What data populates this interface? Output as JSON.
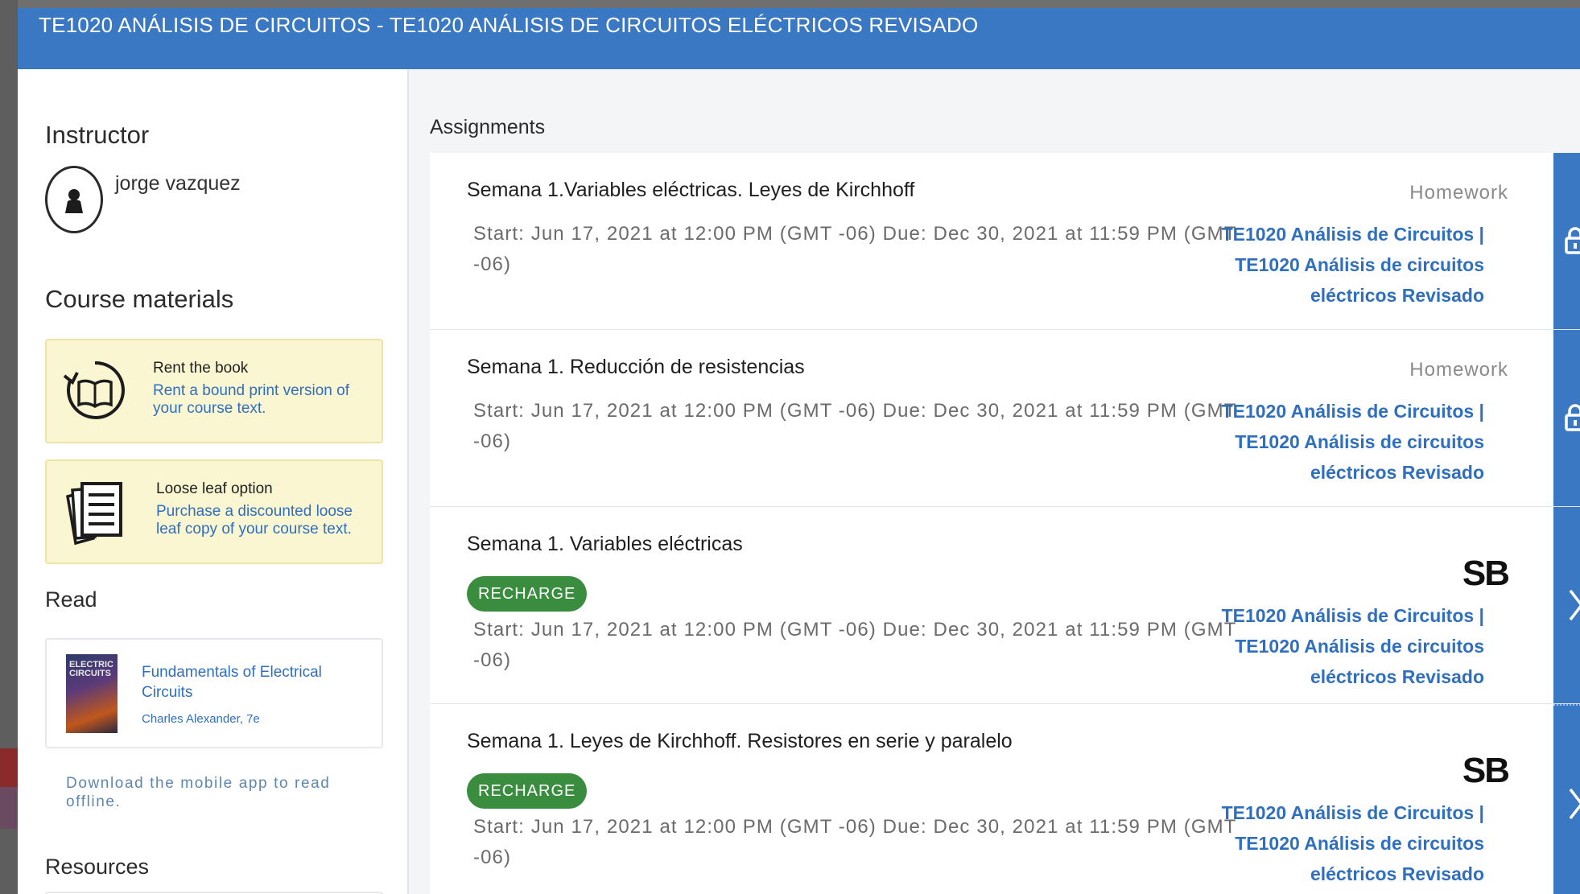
{
  "header": {
    "title": "TE1020 ANÁLISIS DE CIRCUITOS - TE1020 ANÁLISIS DE CIRCUITOS ELÉCTRICOS REVISADO"
  },
  "sidebar": {
    "instructor_heading": "Instructor",
    "instructor_name": "jorge vazquez",
    "course_materials_heading": "Course materials",
    "materials": [
      {
        "title": "Rent the book",
        "description": "Rent a bound print version of your course text.",
        "icon": "rent-book-icon"
      },
      {
        "title": "Loose leaf option",
        "description": "Purchase a discounted loose leaf copy of your course text.",
        "icon": "loose-leaf-icon"
      }
    ],
    "read_heading": "Read",
    "book": {
      "cover_text": "ELECTRIC CIRCUITS",
      "title": "Fundamentals of Electrical Circuits",
      "author": "Charles Alexander, 7e"
    },
    "download_link": "Download the mobile app to read offline.",
    "resources_heading": "Resources"
  },
  "main": {
    "heading": "Assignments",
    "assignments": [
      {
        "title": "Semana 1.Variables eléctricas. Leyes de Kirchhoff",
        "type": "Homework",
        "dates": "Start: Jun 17, 2021 at 12:00 PM (GMT -06)  Due: Dec 30, 2021 at 11:59 PM (GMT -06)",
        "course": "TE1020 Análisis de Circuitos | TE1020 Análisis de circuitos eléctricos Revisado",
        "action_icon": "lock-icon"
      },
      {
        "title": "Semana 1. Reducción de resistencias",
        "type": "Homework",
        "dates": "Start: Jun 17, 2021 at 12:00 PM (GMT -06)  Due: Dec 30, 2021 at 11:59 PM (GMT -06)",
        "course": "TE1020 Análisis de Circuitos | TE1020 Análisis de circuitos eléctricos Revisado",
        "action_icon": "lock-icon"
      },
      {
        "title": "Semana 1. Variables eléctricas",
        "type_logo": "SB",
        "badge": "RECHARGE",
        "dates": "Start: Jun 17, 2021 at 12:00 PM (GMT -06)  Due: Dec 30, 2021 at 11:59 PM (GMT -06)",
        "course": "TE1020 Análisis de Circuitos | TE1020 Análisis de circuitos eléctricos Revisado",
        "action_icon": "chevron-right-icon"
      },
      {
        "title": "Semana 1. Leyes de Kirchhoff. Resistores en serie y paralelo",
        "type_logo": "SB",
        "badge": "RECHARGE",
        "dates": "Start: Jun 17, 2021 at 12:00 PM (GMT -06)  Due: Dec 30, 2021 at 11:59 PM (GMT -06)",
        "course": "TE1020 Análisis de Circuitos | TE1020 Análisis de circuitos eléctricos Revisado",
        "action_icon": "chevron-right-icon"
      }
    ]
  },
  "colors": {
    "header_blue": "#3a78c3",
    "link_blue": "#2f6fbd",
    "recharge_green": "#3a8c3e",
    "material_card_bg": "#fbf6d2"
  }
}
